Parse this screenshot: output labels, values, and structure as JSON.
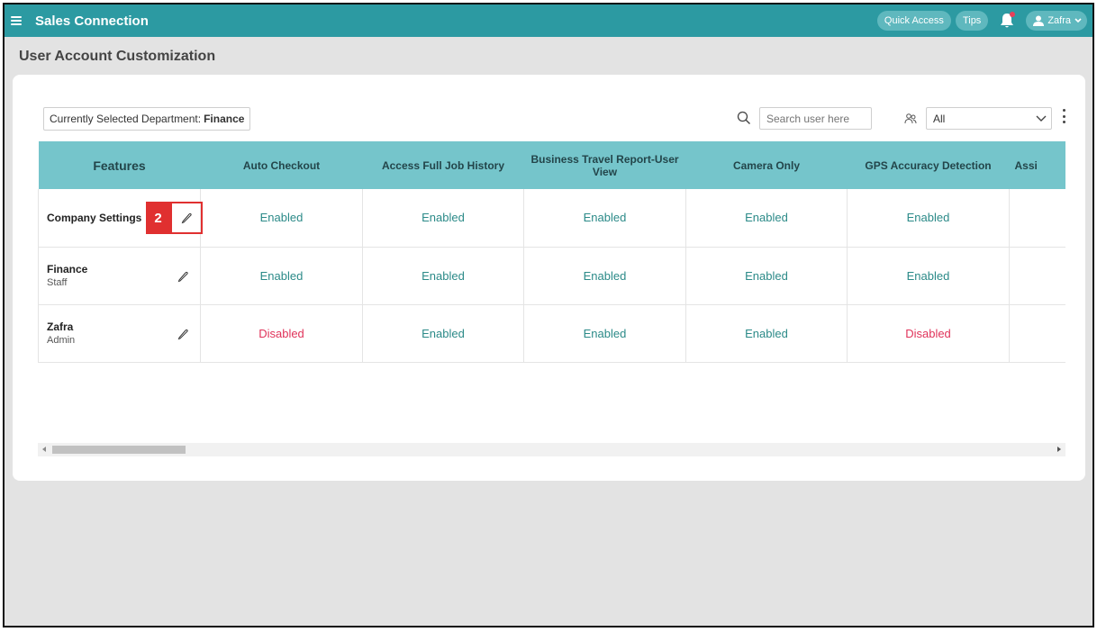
{
  "app": {
    "title": "Sales Connection"
  },
  "header": {
    "quick_access": "Quick Access",
    "tips": "Tips",
    "user_name": "Zafra"
  },
  "page": {
    "title": "User Account Customization"
  },
  "toolbar": {
    "department_label": "Currently Selected Department:",
    "department_value": "Finance",
    "search_placeholder": "Search user here",
    "role_filter": "All"
  },
  "table": {
    "headers": [
      "Features",
      "Auto Checkout",
      "Access Full Job History",
      "Business Travel Report-User View",
      "Camera Only",
      "GPS Accuracy Detection",
      "Assi"
    ],
    "rows": [
      {
        "name": "Company Settings",
        "sub": "",
        "values": [
          "Enabled",
          "Enabled",
          "Enabled",
          "Enabled",
          "Enabled",
          ""
        ]
      },
      {
        "name": "Finance",
        "sub": "Staff",
        "values": [
          "Enabled",
          "Enabled",
          "Enabled",
          "Enabled",
          "Enabled",
          ""
        ]
      },
      {
        "name": "Zafra",
        "sub": "Admin",
        "values": [
          "Disabled",
          "Enabled",
          "Enabled",
          "Enabled",
          "Disabled",
          ""
        ]
      }
    ]
  },
  "annotation": {
    "step": "2"
  },
  "colors": {
    "topbar": "#2c9aa2",
    "header": "#75c5cb",
    "enabled": "#2b8a88",
    "disabled": "#e0335a",
    "highlight": "#e03030"
  }
}
